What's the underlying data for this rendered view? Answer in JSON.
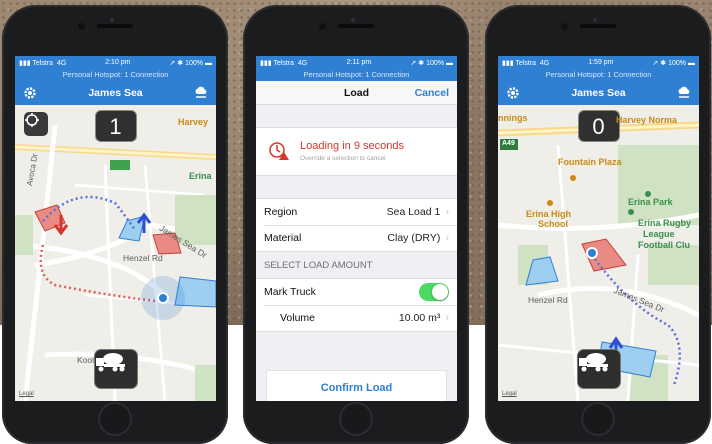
{
  "colors": {
    "nav_blue": "#2f7fd3",
    "alert_red": "#d9342b",
    "toggle_green": "#4cd964"
  },
  "phones": [
    {
      "status": {
        "carrier": "Telstra",
        "network": "4G",
        "time": "2:10 pm",
        "battery": "100%"
      },
      "hotspot": "Personal Hotspot: 1 Connection",
      "title": "James Sea",
      "counter": "1",
      "map_labels": {
        "harvey": "Harvey",
        "erina": "Erina",
        "avoca": "Avoca Dr",
        "henzel": "Henzel Rd",
        "james_sea": "James Sea Dr",
        "koolang": "Koolang Rd",
        "legal": "Legal"
      },
      "icons": {
        "settings": "gear-icon",
        "weather": "cloud-rain-icon",
        "locate": "compass-icon",
        "truck": "cement-truck-icon"
      }
    },
    {
      "status": {
        "carrier": "Telstra",
        "network": "4G",
        "time": "2:11 pm",
        "battery": "100%"
      },
      "hotspot": "Personal Hotspot: 1 Connection",
      "title": "Load",
      "cancel": "Cancel",
      "alert_title": "Loading in 9 seconds",
      "alert_sub": "Override a selection to cancel",
      "rows": [
        {
          "label": "Region",
          "value": "Sea Load 1"
        },
        {
          "label": "Material",
          "value": "Clay (DRY)"
        }
      ],
      "section": "SELECT LOAD AMOUNT",
      "mark_truck": "Mark Truck",
      "mark_truck_on": true,
      "volume_label": "Volume",
      "volume_value": "10.00 m³",
      "confirm": "Confirm Load"
    },
    {
      "status": {
        "carrier": "Telstra",
        "network": "4G",
        "time": "1:59 pm",
        "battery": "100%"
      },
      "hotspot": "Personal Hotspot: 1 Connection",
      "title": "James Sea",
      "counter": "0",
      "map_labels": {
        "nnings": "nnings",
        "harvey": "Harvey Norma",
        "a49": "A49",
        "fountain": "Fountain Plaza",
        "erina_park": "Erina Park",
        "erina_high_1": "Erina High",
        "erina_high_2": "School",
        "rugby_1": "Erina Rugby",
        "rugby_2": "League",
        "rugby_3": "Football Clu",
        "henzel": "Henzel Rd",
        "james_sea": "James Sea Dr",
        "legal": "Legal"
      }
    }
  ]
}
